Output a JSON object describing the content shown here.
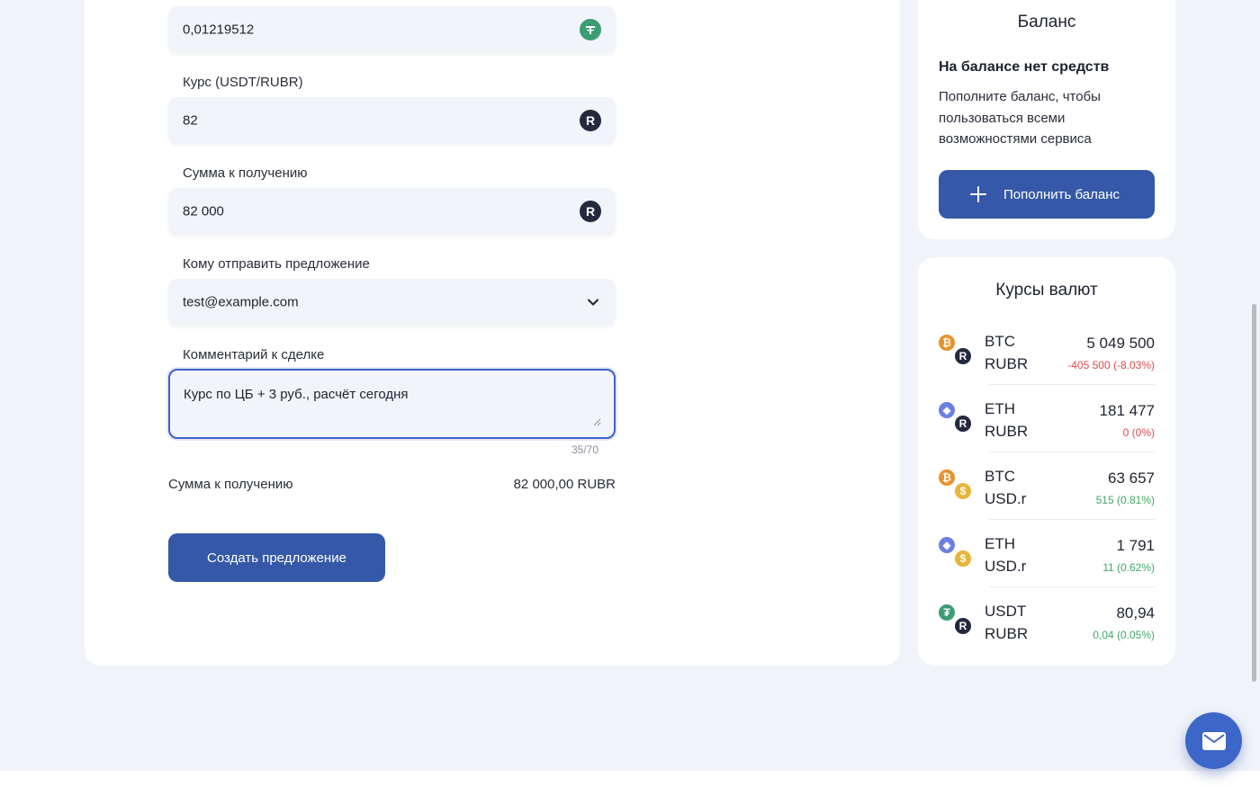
{
  "form": {
    "amount_field": {
      "value": "0,01219512",
      "icon": "usdt-icon"
    },
    "rate_field": {
      "label": "Курс (USDT/RUBR)",
      "value": "82",
      "icon": "rubr-icon"
    },
    "receive_field": {
      "label": "Сумма к получению",
      "value": "82 000",
      "icon": "rubr-icon"
    },
    "recipient_field": {
      "label": "Кому отправить предложение",
      "value": "test@example.com"
    },
    "comment_field": {
      "label": "Комментарий к сделке",
      "value": "Курс по ЦБ + 3 руб., расчёт сегодня",
      "counter": "35/70"
    },
    "summary": {
      "label": "Сумма к получению",
      "value": "82 000,00 RUBR"
    },
    "create_button_label": "Создать предложение"
  },
  "balance": {
    "title": "Баланс",
    "empty_title": "На балансе нет средств",
    "description": "Пополните баланс, чтобы пользоваться всеми возможностями сервиса",
    "topup_button_label": "Пополнить баланс"
  },
  "rates": {
    "title": "Курсы валют",
    "items": [
      {
        "base": "BTC",
        "quote": "RUBR",
        "price": "5 049 500",
        "change": "-405 500 (-8.03%)",
        "trend": "negative",
        "base_icon": "btc-icon",
        "quote_icon": "rubr-icon"
      },
      {
        "base": "ETH",
        "quote": "RUBR",
        "price": "181 477",
        "change": "0 (0%)",
        "trend": "negative",
        "base_icon": "eth-icon",
        "quote_icon": "rubr-icon"
      },
      {
        "base": "BTC",
        "quote": "USD.r",
        "price": "63 657",
        "change": "515 (0.81%)",
        "trend": "positive",
        "base_icon": "btc-icon",
        "quote_icon": "usdr-icon"
      },
      {
        "base": "ETH",
        "quote": "USD.r",
        "price": "1 791",
        "change": "11 (0.62%)",
        "trend": "positive",
        "base_icon": "eth-icon",
        "quote_icon": "usdr-icon"
      },
      {
        "base": "USDT",
        "quote": "RUBR",
        "price": "80,94",
        "change": "0,04 (0.05%)",
        "trend": "positive",
        "base_icon": "usdt-icon",
        "quote_icon": "rubr-icon"
      }
    ]
  },
  "colors": {
    "accent": "#3558a8",
    "negative": "#e0484e",
    "positive": "#3fa865",
    "background": "#f0f3f9"
  }
}
